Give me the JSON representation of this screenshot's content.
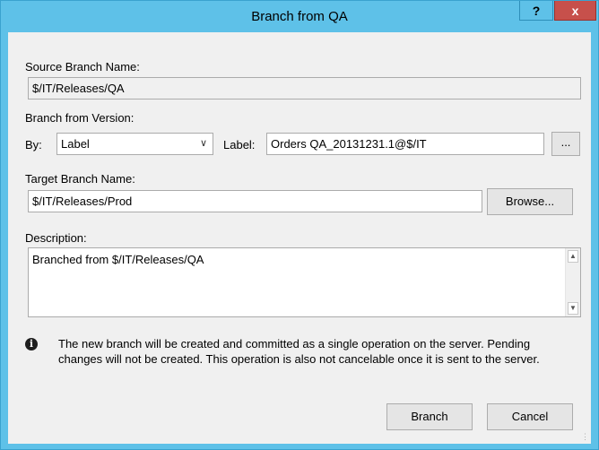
{
  "window": {
    "title": "Branch from QA",
    "help_label": "?",
    "close_label": "x"
  },
  "source": {
    "label": "Source Branch Name:",
    "value": "$/IT/Releases/QA"
  },
  "version": {
    "label": "Branch from Version:",
    "by_label": "By:",
    "by_value": "Label",
    "label_label": "Label:",
    "label_value": "Orders QA_20131231.1@$/IT",
    "browse_label_button": "..."
  },
  "target": {
    "label": "Target Branch Name:",
    "value": "$/IT/Releases/Prod",
    "browse_button": "Browse..."
  },
  "description": {
    "label": "Description:",
    "value": "Branched from $/IT/Releases/QA"
  },
  "info": {
    "text": "The new branch will be created and committed as a single operation on the server. Pending changes will not be created. This operation is also not cancelable once it is sent to the server."
  },
  "buttons": {
    "branch": "Branch",
    "cancel": "Cancel"
  }
}
